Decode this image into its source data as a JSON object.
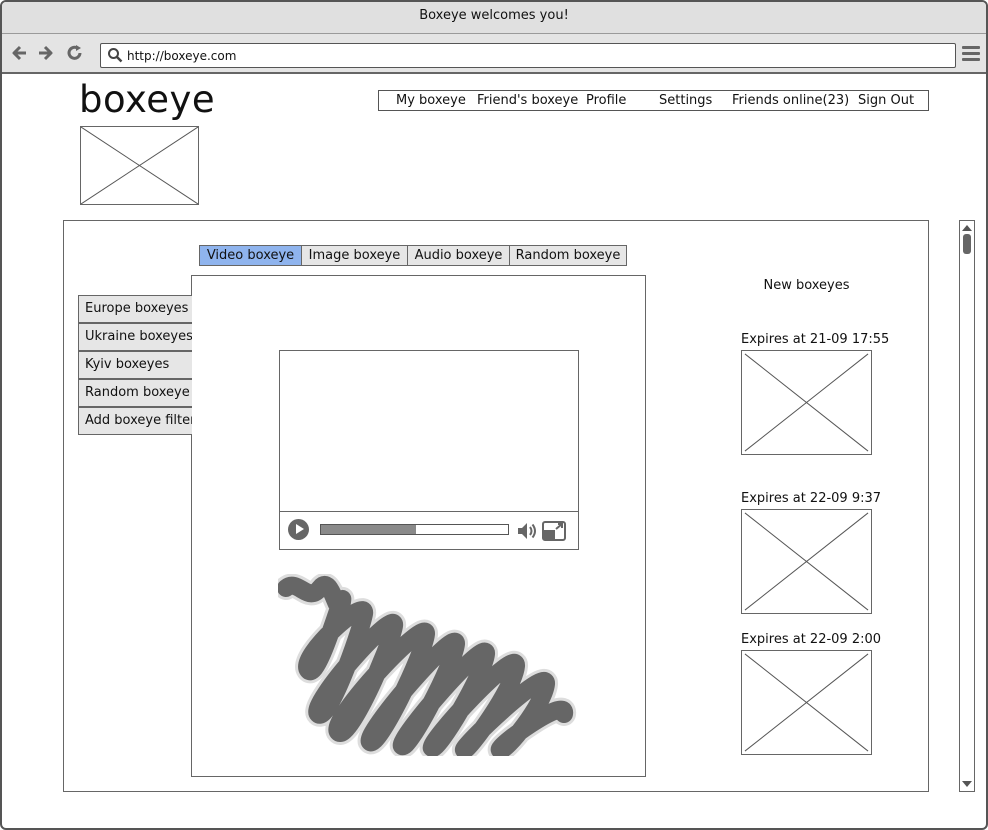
{
  "window": {
    "title": "Boxeye welcomes you!"
  },
  "browser": {
    "url": "http://boxeye.com",
    "icons": {
      "back": "arrow-left-icon",
      "forward": "arrow-right-icon",
      "reload": "reload-icon",
      "search": "search-icon",
      "menu": "hamburger-menu-icon"
    }
  },
  "site": {
    "logo_text": "boxeye"
  },
  "topnav": {
    "items": [
      {
        "label": "My boxeye"
      },
      {
        "label": "Friend's boxeye"
      },
      {
        "label": "Profile"
      },
      {
        "label": "Settings"
      },
      {
        "label": "Friends online(23)"
      },
      {
        "label": "Sign Out"
      }
    ]
  },
  "tabs": {
    "items": [
      {
        "label": "Video boxeye",
        "active": true
      },
      {
        "label": "Image boxeye",
        "active": false
      },
      {
        "label": "Audio boxeye",
        "active": false
      },
      {
        "label": "Random boxeye",
        "active": false
      }
    ],
    "active_color": "#8fb4ee"
  },
  "sidebar": {
    "items": [
      {
        "label": "Europe boxeyes"
      },
      {
        "label": "Ukraine boxeyes"
      },
      {
        "label": "Kyiv boxeyes"
      },
      {
        "label": "Random boxeye"
      },
      {
        "label": "Add boxeye filter..."
      }
    ]
  },
  "video": {
    "progress": 0.51,
    "icons": {
      "play": "play-icon",
      "volume": "volume-icon",
      "fullscreen": "fullscreen-icon"
    }
  },
  "new_boxeyes": {
    "title": "New boxeyes",
    "items": [
      {
        "expires": "Expires at 21-09 17:55"
      },
      {
        "expires": "Expires at 22-09 9:37"
      },
      {
        "expires": "Expires at 22-09 2:00"
      }
    ]
  }
}
